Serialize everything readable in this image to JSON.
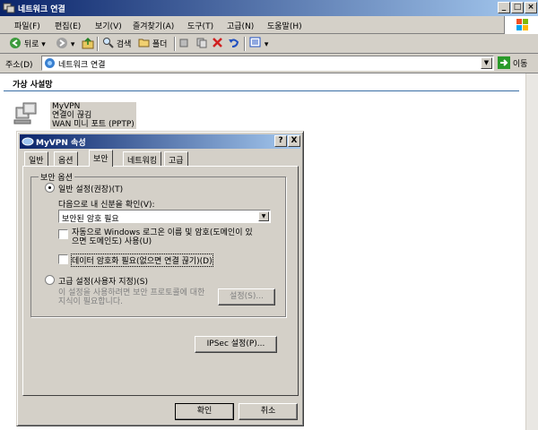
{
  "window": {
    "title": "네트워크 연결"
  },
  "menu": [
    "파일(F)",
    "편집(E)",
    "보기(V)",
    "즐겨찾기(A)",
    "도구(T)",
    "고급(N)",
    "도움말(H)"
  ],
  "toolbar": {
    "back": "뒤로",
    "search": "검색",
    "folders": "폴더"
  },
  "address": {
    "label": "주소(D)",
    "value": "네트워크 연결",
    "go": "이동"
  },
  "content": {
    "group_header": "가상 사설망",
    "connection": {
      "name": "MyVPN",
      "status": "연결이 끊김",
      "device": "WAN 미니 포트 (PPTP)"
    }
  },
  "dialog": {
    "title": "MyVPN 속성",
    "tabs": [
      "일반",
      "옵션",
      "보안",
      "네트워킹",
      "고급"
    ],
    "active_tab": "보안",
    "group_title": "보안 옵션",
    "typical_radio": "일반 설정(권장)(T)",
    "verify_label": "다음으로 내 신분을 확인(V):",
    "verify_value": "보안된 암호 필요",
    "auto_logon": "자동으로 Windows 로그온 이름 및 암호(도메인이 있으면 도메인도) 사용(U)",
    "auto_logon_line1": "자동으로 Windows 로그온 이름 및 암호(도메인이 있",
    "auto_logon_line2": "으면 도메인도) 사용(U)",
    "require_encryption": "데이터 암호화 필요(없으면 연결 끊기)(D)",
    "advanced_radio": "고급 설정(사용자 지정)(S)",
    "advanced_desc_line1": "이 설정을 사용하려면 보안 프로토콜에 대한",
    "advanced_desc_line2": "지식이 필요합니다.",
    "settings_button": "설정(S)...",
    "ipsec_button": "IPSec 설정(P)...",
    "ok_button": "확인",
    "cancel_button": "취소",
    "help_button": "?",
    "close_button": "X"
  }
}
